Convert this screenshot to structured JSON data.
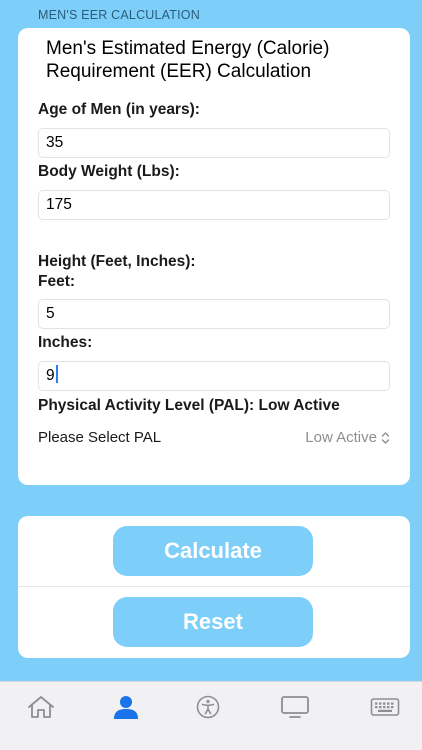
{
  "section_header": "MEN'S EER CALCULATION",
  "form": {
    "title": "Men's Estimated Energy (Calorie) Requirement (EER) Calculation",
    "age_label": "Age of Men (in years):",
    "age_value": "35",
    "weight_label": "Body Weight (Lbs):",
    "weight_value": "175",
    "height_label": "Height (Feet, Inches):",
    "feet_label": "Feet:",
    "feet_value": "5",
    "inches_label": "Inches:",
    "inches_value": "9",
    "pal_heading": "Physical Activity Level (PAL): Low Active",
    "pal_select_label": "Please Select PAL",
    "pal_selected": "Low Active"
  },
  "actions": {
    "calculate_label": "Calculate",
    "reset_label": "Reset"
  },
  "tabbar": {
    "tabs": [
      {
        "icon": "home-icon",
        "active": false
      },
      {
        "icon": "person-icon",
        "active": true
      },
      {
        "icon": "accessibility-icon",
        "active": false
      },
      {
        "icon": "display-icon",
        "active": false
      },
      {
        "icon": "keyboard-icon",
        "active": false
      }
    ]
  },
  "colors": {
    "background": "#7dcffa",
    "button": "#7dcffa",
    "tab_active": "#1a73e8",
    "tab_inactive": "#8e8e93"
  }
}
